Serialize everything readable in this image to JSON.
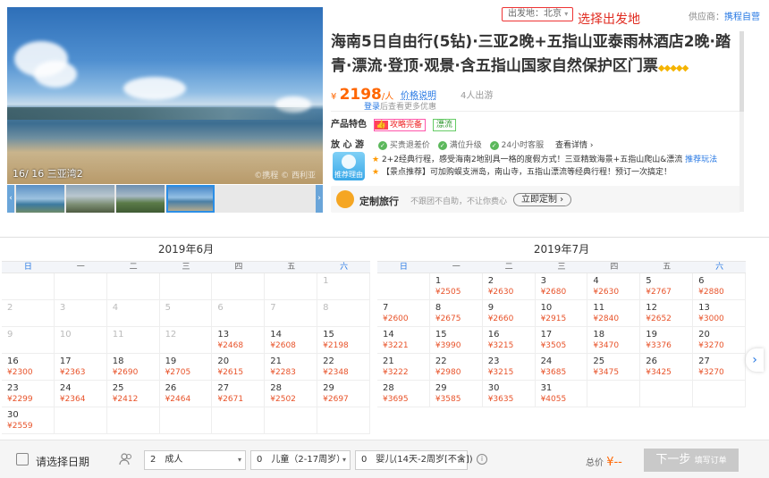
{
  "gallery": {
    "counter": "16/ 16 三亚湾2",
    "watermark": "©携程 © 西利亚",
    "prev_arrow": "‹",
    "next_arrow": "›"
  },
  "header": {
    "departure_label": "出发地：北京",
    "departure_chevron": "▾",
    "annotation": "选择出发地",
    "supplier_prefix": "供应商：",
    "supplier_name": "携程自营"
  },
  "product": {
    "title": "海南5日自由行(5钻)·三亚2晚+五指山亚泰雨林酒店2晚·踏青·漂流·登顶·观景·含五指山国家自然保护区门票",
    "diamonds": "◆◆◆◆◆",
    "price_currency": "¥",
    "price_value": "2198",
    "price_unit": "/人",
    "price_note": "价格说明",
    "min_people": "4人出游",
    "login_link": "登录",
    "login_suffix": "后查看更多优惠"
  },
  "features": {
    "label": "产品特色",
    "tag1_icon": "👍",
    "tag1": "攻略完备",
    "tag2": "漂流"
  },
  "assurance": {
    "label": "放 心 游",
    "items": [
      "买贵退差价",
      "满位升级",
      "24小时客服"
    ],
    "more": "查看详情 ›"
  },
  "recommend": {
    "badge": "推荐理由",
    "line1_star": "★",
    "line1": "2+2经典行程，感受海南2地别具一格的度假方式！三亚精致海景+五指山爬山&漂流",
    "line1_link": "推荐玩法",
    "line2_star": "★",
    "line2": "【景点推荐】可加购蜈支洲岛，南山寺，五指山漂流等经典行程！预订一次搞定！"
  },
  "custom": {
    "title": "定制旅行",
    "desc": "不跟团不自助，不让你费心",
    "button": "立即定制 ›"
  },
  "calendar": {
    "weekdays": [
      "日",
      "一",
      "二",
      "三",
      "四",
      "五",
      "六"
    ],
    "months": [
      {
        "title": "2019年6月",
        "days": [
          {
            "d": "",
            "p": ""
          },
          {
            "d": "",
            "p": ""
          },
          {
            "d": "",
            "p": ""
          },
          {
            "d": "",
            "p": ""
          },
          {
            "d": "",
            "p": ""
          },
          {
            "d": "",
            "p": ""
          },
          {
            "d": "1",
            "p": "",
            "dis": true
          },
          {
            "d": "2",
            "p": "",
            "dis": true
          },
          {
            "d": "3",
            "p": "",
            "dis": true
          },
          {
            "d": "4",
            "p": "",
            "dis": true
          },
          {
            "d": "5",
            "p": "",
            "dis": true
          },
          {
            "d": "6",
            "p": "",
            "dis": true
          },
          {
            "d": "7",
            "p": "",
            "dis": true
          },
          {
            "d": "8",
            "p": "",
            "dis": true
          },
          {
            "d": "9",
            "p": "",
            "dis": true
          },
          {
            "d": "10",
            "p": "",
            "dis": true
          },
          {
            "d": "11",
            "p": "",
            "dis": true
          },
          {
            "d": "12",
            "p": "",
            "dis": true
          },
          {
            "d": "13",
            "p": "¥2468"
          },
          {
            "d": "14",
            "p": "¥2608"
          },
          {
            "d": "15",
            "p": "¥2198"
          },
          {
            "d": "16",
            "p": "¥2300"
          },
          {
            "d": "17",
            "p": "¥2363"
          },
          {
            "d": "18",
            "p": "¥2690"
          },
          {
            "d": "19",
            "p": "¥2705"
          },
          {
            "d": "20",
            "p": "¥2615"
          },
          {
            "d": "21",
            "p": "¥2283"
          },
          {
            "d": "22",
            "p": "¥2348"
          },
          {
            "d": "23",
            "p": "¥2299"
          },
          {
            "d": "24",
            "p": "¥2364"
          },
          {
            "d": "25",
            "p": "¥2412"
          },
          {
            "d": "26",
            "p": "¥2464"
          },
          {
            "d": "27",
            "p": "¥2671"
          },
          {
            "d": "28",
            "p": "¥2502"
          },
          {
            "d": "29",
            "p": "¥2697"
          },
          {
            "d": "30",
            "p": "¥2559"
          },
          {
            "d": "",
            "p": ""
          },
          {
            "d": "",
            "p": ""
          },
          {
            "d": "",
            "p": ""
          },
          {
            "d": "",
            "p": ""
          },
          {
            "d": "",
            "p": ""
          },
          {
            "d": "",
            "p": ""
          }
        ]
      },
      {
        "title": "2019年7月",
        "days": [
          {
            "d": "",
            "p": ""
          },
          {
            "d": "1",
            "p": "¥2505"
          },
          {
            "d": "2",
            "p": "¥2630"
          },
          {
            "d": "3",
            "p": "¥2680"
          },
          {
            "d": "4",
            "p": "¥2630"
          },
          {
            "d": "5",
            "p": "¥2767"
          },
          {
            "d": "6",
            "p": "¥2880"
          },
          {
            "d": "7",
            "p": "¥2600"
          },
          {
            "d": "8",
            "p": "¥2675"
          },
          {
            "d": "9",
            "p": "¥2660"
          },
          {
            "d": "10",
            "p": "¥2915"
          },
          {
            "d": "11",
            "p": "¥2840"
          },
          {
            "d": "12",
            "p": "¥2652"
          },
          {
            "d": "13",
            "p": "¥3000"
          },
          {
            "d": "14",
            "p": "¥3221"
          },
          {
            "d": "15",
            "p": "¥3990"
          },
          {
            "d": "16",
            "p": "¥3215"
          },
          {
            "d": "17",
            "p": "¥3505"
          },
          {
            "d": "18",
            "p": "¥3470"
          },
          {
            "d": "19",
            "p": "¥3376"
          },
          {
            "d": "20",
            "p": "¥3270"
          },
          {
            "d": "21",
            "p": "¥3222"
          },
          {
            "d": "22",
            "p": "¥2980"
          },
          {
            "d": "23",
            "p": "¥3215"
          },
          {
            "d": "24",
            "p": "¥3685"
          },
          {
            "d": "25",
            "p": "¥3475"
          },
          {
            "d": "26",
            "p": "¥3425"
          },
          {
            "d": "27",
            "p": "¥3270"
          },
          {
            "d": "28",
            "p": "¥3695"
          },
          {
            "d": "29",
            "p": "¥3585"
          },
          {
            "d": "30",
            "p": "¥3635"
          },
          {
            "d": "31",
            "p": "¥4055"
          },
          {
            "d": "",
            "p": ""
          },
          {
            "d": "",
            "p": ""
          },
          {
            "d": "",
            "p": ""
          }
        ]
      }
    ],
    "next_arrow": "›"
  },
  "booking": {
    "date_label": "请选择日期",
    "adults_count": "2",
    "adults_label": "成人",
    "children_count": "0",
    "children_label": "儿童（2-17周岁）",
    "infants_count": "0",
    "infants_label": "婴儿(14天-2周岁[不含])",
    "caret": "▾",
    "info_icon": "i",
    "total_label": "总价",
    "total_currency": "¥",
    "total_value": "--",
    "next_label": "下一步",
    "next_sub": "填写订单"
  },
  "colors": {
    "accent_blue": "#2577e3",
    "price_orange": "#f60",
    "annotation_red": "#e02b20"
  }
}
